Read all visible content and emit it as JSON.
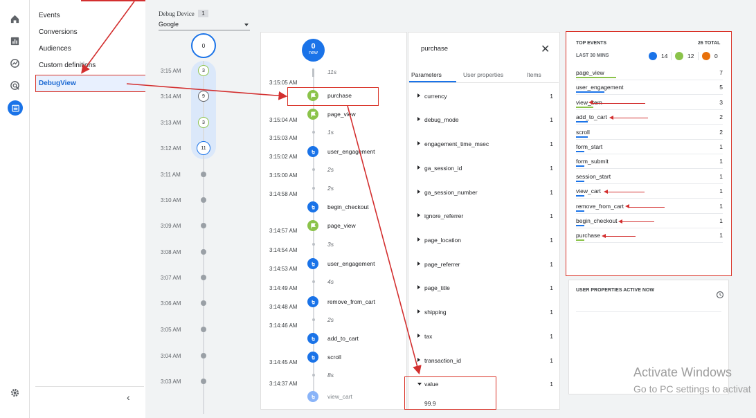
{
  "nav": {
    "items": [
      "Events",
      "Conversions",
      "Audiences",
      "Custom definitions"
    ],
    "selected": "DebugView"
  },
  "device": {
    "label": "Debug Device",
    "count": "1",
    "selected": "Google"
  },
  "minutes": {
    "top_count": "0",
    "rows": [
      {
        "time": "3:15 AM",
        "count": "3"
      },
      {
        "time": "3:14 AM",
        "count": "9"
      },
      {
        "time": "3:13 AM",
        "count": "3"
      },
      {
        "time": "3:12 AM",
        "count": "11"
      },
      {
        "time": "3:11 AM",
        "count": ""
      },
      {
        "time": "3:10 AM",
        "count": ""
      },
      {
        "time": "3:09 AM",
        "count": ""
      },
      {
        "time": "3:08 AM",
        "count": ""
      },
      {
        "time": "3:07 AM",
        "count": ""
      },
      {
        "time": "3:06 AM",
        "count": ""
      },
      {
        "time": "3:05 AM",
        "count": ""
      },
      {
        "time": "3:04 AM",
        "count": ""
      },
      {
        "time": "3:03 AM",
        "count": ""
      }
    ]
  },
  "stream": {
    "new_count": "0",
    "new_label": "new",
    "gap_top": "11s",
    "times": [
      "3:15:05 AM",
      "3:15:04 AM",
      "3:15:03 AM",
      "3:15:02 AM",
      "3:15:00 AM",
      "3:14:58 AM",
      "3:14:57 AM",
      "3:14:54 AM",
      "3:14:53 AM",
      "3:14:49 AM",
      "3:14:48 AM",
      "3:14:46 AM",
      "3:14:45 AM",
      "3:14:37 AM"
    ],
    "events": [
      "purchase",
      "page_view",
      "user_engagement",
      "begin_checkout",
      "page_view",
      "user_engagement",
      "remove_from_cart",
      "add_to_cart",
      "scroll",
      "view_cart"
    ],
    "gaps": [
      "1s",
      "2s",
      "2s",
      "3s",
      "4s",
      "2s",
      "8s"
    ]
  },
  "params_panel": {
    "title": "purchase",
    "tabs": [
      "Parameters",
      "User properties",
      "Items"
    ],
    "rows": [
      {
        "name": "currency",
        "count": "1"
      },
      {
        "name": "debug_mode",
        "count": "1"
      },
      {
        "name": "engagement_time_msec",
        "count": "1"
      },
      {
        "name": "ga_session_id",
        "count": "1"
      },
      {
        "name": "ga_session_number",
        "count": "1"
      },
      {
        "name": "ignore_referrer",
        "count": "1"
      },
      {
        "name": "page_location",
        "count": "1"
      },
      {
        "name": "page_referrer",
        "count": "1"
      },
      {
        "name": "page_title",
        "count": "1"
      },
      {
        "name": "shipping",
        "count": "1"
      },
      {
        "name": "tax",
        "count": "1"
      },
      {
        "name": "transaction_id",
        "count": "1"
      },
      {
        "name": "value",
        "count": "1"
      }
    ],
    "value_expanded": "99.9"
  },
  "top_events": {
    "title": "TOP EVENTS",
    "total": "26 TOTAL",
    "period": "LAST 30 MINS",
    "counts": {
      "blue": "14",
      "green": "12",
      "orange": "0"
    },
    "rows": [
      {
        "name": "page_view",
        "count": "7",
        "color": "#8bc34a",
        "bar": 1.0
      },
      {
        "name": "user_engagement",
        "count": "5",
        "color": "#1a73e8",
        "bar": 0.71
      },
      {
        "name": "view_item",
        "count": "3",
        "color": "#8bc34a",
        "bar": 0.43
      },
      {
        "name": "add_to_cart",
        "count": "2",
        "color": "#1a73e8",
        "bar": 0.29
      },
      {
        "name": "scroll",
        "count": "2",
        "color": "#1a73e8",
        "bar": 0.29
      },
      {
        "name": "form_start",
        "count": "1",
        "color": "#1a73e8",
        "bar": 0.14
      },
      {
        "name": "form_submit",
        "count": "1",
        "color": "#1a73e8",
        "bar": 0.14
      },
      {
        "name": "session_start",
        "count": "1",
        "color": "#1a73e8",
        "bar": 0.14
      },
      {
        "name": "view_cart",
        "count": "1",
        "color": "#1a73e8",
        "bar": 0.14
      },
      {
        "name": "remove_from_cart",
        "count": "1",
        "color": "#1a73e8",
        "bar": 0.14
      },
      {
        "name": "begin_checkout",
        "count": "1",
        "color": "#1a73e8",
        "bar": 0.14
      },
      {
        "name": "purchase",
        "count": "1",
        "color": "#8bc34a",
        "bar": 0.14
      }
    ]
  },
  "user_props": {
    "title": "USER PROPERTIES ACTIVE NOW"
  },
  "watermark": {
    "line1": "Activate Windows",
    "line2": "Go to PC settings to activat"
  },
  "colors": {
    "accent": "#1a73e8",
    "conversion": "#8bc34a",
    "error": "#e8710a",
    "annotation": "#d32f2f"
  }
}
